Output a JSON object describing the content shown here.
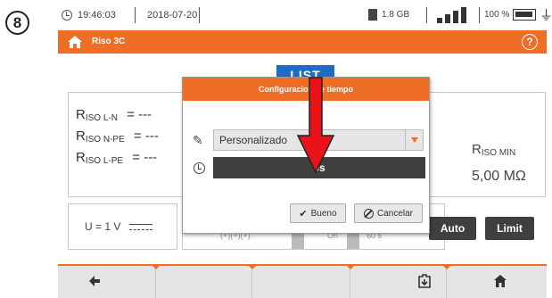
{
  "step_badge": "8",
  "status_bar": {
    "time": "19:46:03",
    "date": "2018-07-20",
    "storage": "1.8 GB",
    "battery": "100 %"
  },
  "title_bar": {
    "title": "Riso 3C",
    "help_label": "?"
  },
  "tab": {
    "label": "LIST"
  },
  "results": {
    "lines": [
      {
        "base": "R",
        "sub": "ISO L-N",
        "value": "= ---"
      },
      {
        "base": "R",
        "sub": "ISO N-PE",
        "value": "= ---"
      },
      {
        "base": "R",
        "sub": "ISO L-PE",
        "value": "= ---"
      }
    ],
    "min_label_base": "R",
    "min_label_sub": "ISO MIN",
    "min_value": "5,00 MΩ"
  },
  "voltage": {
    "label": "U = 1 V"
  },
  "settings_strip": {
    "ghost_text_1": "(+)(+)(+)",
    "ghost_text_2": "On",
    "ghost_text_3": "60 s"
  },
  "buttons": {
    "auto": "Auto",
    "limit": "Limit"
  },
  "dialog": {
    "title": "Configuracion de tiempo",
    "mode_value": "Personalizado",
    "time_value": "0s",
    "ok_label": "Bueno",
    "cancel_label": "Cancelar"
  },
  "colors": {
    "accent": "#ef6e25",
    "tab_blue": "#1f6cc4",
    "dark_button": "#3f3f3f",
    "arrow_red": "#e8141a"
  },
  "icons": {
    "status": [
      "clock-icon",
      "sd-card-icon",
      "signal-icon",
      "battery-icon",
      "plug-icon"
    ],
    "nav": [
      "back-arrow-icon",
      "save-icon",
      "home-icon"
    ]
  }
}
